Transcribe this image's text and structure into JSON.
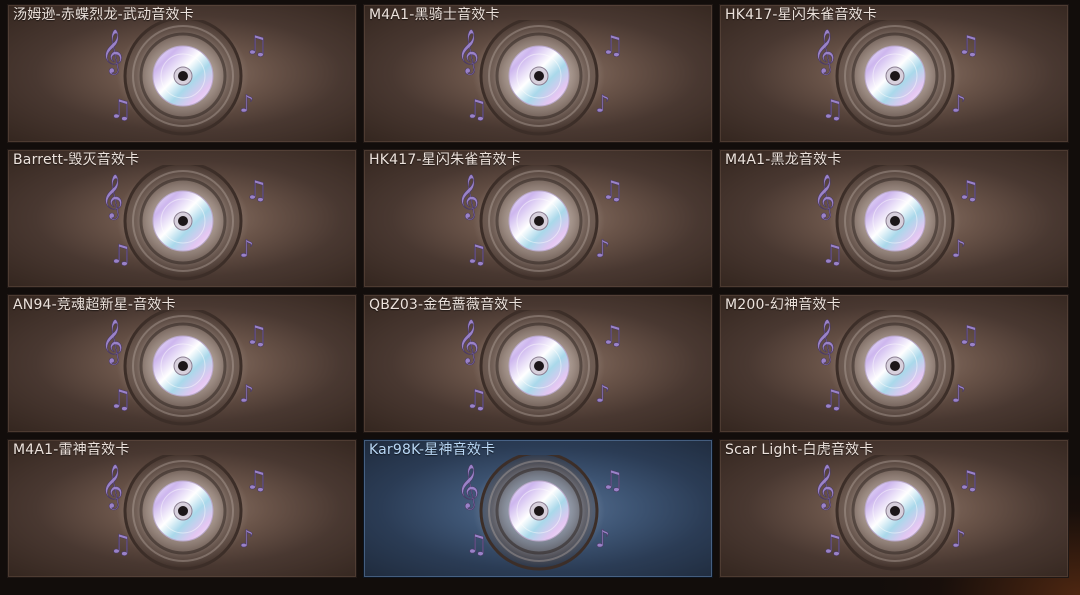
{
  "cards": [
    {
      "title": "汤姆逊-赤蝶烈龙-武动音效卡",
      "selected": false,
      "icon": "music-cd-icon"
    },
    {
      "title": "M4A1-黑骑士音效卡",
      "selected": false,
      "icon": "music-cd-icon"
    },
    {
      "title": "HK417-星闪朱雀音效卡",
      "selected": false,
      "icon": "music-cd-icon"
    },
    {
      "title": "Barrett-毁灭音效卡",
      "selected": false,
      "icon": "music-cd-icon"
    },
    {
      "title": "HK417-星闪朱雀音效卡",
      "selected": false,
      "icon": "music-cd-icon"
    },
    {
      "title": "M4A1-黑龙音效卡",
      "selected": false,
      "icon": "music-cd-icon"
    },
    {
      "title": "AN94-竞魂超新星-音效卡",
      "selected": false,
      "icon": "music-cd-icon"
    },
    {
      "title": "QBZ03-金色蔷薇音效卡",
      "selected": false,
      "icon": "music-cd-icon"
    },
    {
      "title": "M200-幻神音效卡",
      "selected": false,
      "icon": "music-cd-icon"
    },
    {
      "title": "M4A1-雷神音效卡",
      "selected": false,
      "icon": "music-cd-icon"
    },
    {
      "title": "Kar98K-星神音效卡",
      "selected": true,
      "icon": "music-cd-icon"
    },
    {
      "title": "Scar Light-白虎音效卡",
      "selected": false,
      "icon": "music-cd-icon"
    }
  ],
  "colors": {
    "card_bg": "#5a463d",
    "selected_bg": "#3e5574",
    "note_purple": "#9a82c8",
    "title_text": "#ece2dc",
    "selected_title_text": "#b9d7f4"
  }
}
